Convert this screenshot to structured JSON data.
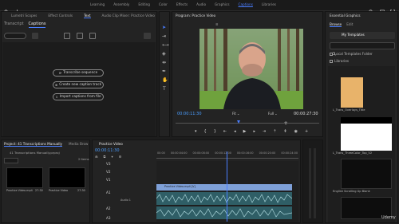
{
  "menu": {
    "items": [
      "Learning",
      "Assembly",
      "Editing",
      "Color",
      "Effects",
      "Audio",
      "Graphics",
      "Captions",
      "Libraries"
    ],
    "active": "Captions"
  },
  "left_panel": {
    "tabs": [
      "Lumetri Scopes",
      "Effect Controls",
      "Text",
      "Audio Clip Mixer: Practice Video"
    ],
    "subtabs": [
      "Transcript",
      "Captions"
    ],
    "buttons": [
      "Transcribe sequence",
      "Create new caption track",
      "Import captions from file"
    ]
  },
  "program": {
    "title": "Program: Practice Video",
    "timecode_left": "00:00:11:30",
    "timecode_right": "00:00:27:30",
    "fit": "Fit",
    "quality": "Full"
  },
  "essential_graphics": {
    "title": "Essential Graphics",
    "tabs": [
      "Browse",
      "Edit"
    ],
    "my_templates": "My Templates",
    "local_folder": "Local Templates Folder",
    "libraries": "Libraries",
    "templates": [
      {
        "name": "L_Trans_Overlays_Title",
        "color": "#e8b36a"
      },
      {
        "name": "L_Trans_ThreeColor_Top_V2",
        "color": "#ffffff"
      },
      {
        "name": "English Scrolling Up Blank",
        "color": "#0d0d0d"
      }
    ]
  },
  "project": {
    "title": "Project: 41 Transcriptions Manually",
    "media_browser": "Media Brow",
    "path": "41 Transcriptions Manually.prproj",
    "items_count": "2 Items",
    "items": [
      {
        "name": "Practice Video.mp4",
        "duration": "27:30"
      },
      {
        "name": "Practice Video",
        "duration": "27:30"
      }
    ]
  },
  "timeline": {
    "tab": "Practice Video",
    "timecode": "00:00:11:30",
    "ruler": [
      "00:00",
      "00:00:04:00",
      "00:00:08:00",
      "00:00:12:00",
      "00:00:16:00",
      "00:00:20:00",
      "00:00:24:00"
    ],
    "tracks": [
      "V3",
      "V2",
      "V1",
      "A1",
      "A2",
      "A3"
    ],
    "clip_label": "Practice Video.mp4 [V]",
    "audio_label": "Audio 1"
  },
  "watermark": "Udemy"
}
